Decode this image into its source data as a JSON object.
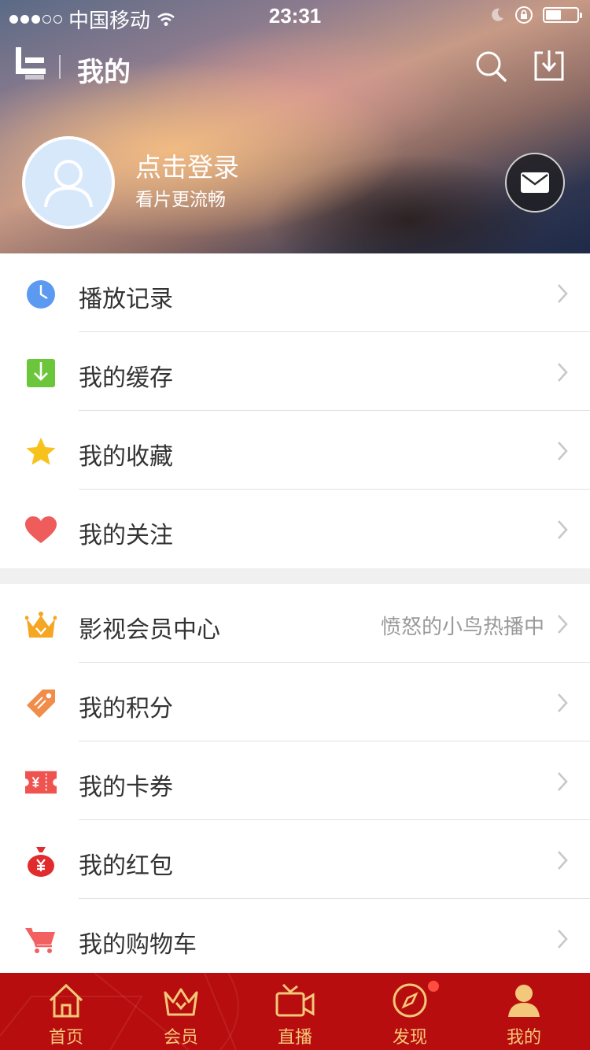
{
  "status_bar": {
    "carrier": "中国移动",
    "time": "23:31"
  },
  "header": {
    "title": "我的",
    "login_title": "点击登录",
    "login_subtitle": "看片更流畅"
  },
  "menu_group_1": [
    {
      "label": "播放记录",
      "icon": "clock-icon",
      "color": "#5b9af0"
    },
    {
      "label": "我的缓存",
      "icon": "download-box-icon",
      "color": "#6cc63c"
    },
    {
      "label": "我的收藏",
      "icon": "star-icon",
      "color": "#f7c21c"
    },
    {
      "label": "我的关注",
      "icon": "heart-icon",
      "color": "#ef5c5c"
    }
  ],
  "menu_group_2": [
    {
      "label": "影视会员中心",
      "extra": "愤怒的小鸟热播中",
      "icon": "crown-icon",
      "color": "#f5a623"
    },
    {
      "label": "我的积分",
      "icon": "tag-icon",
      "color": "#f08d4b"
    },
    {
      "label": "我的卡券",
      "icon": "ticket-icon",
      "color": "#ef5350"
    },
    {
      "label": "我的红包",
      "icon": "money-bag-icon",
      "color": "#e02c2c"
    },
    {
      "label": "我的购物车",
      "icon": "cart-icon",
      "color": "#f26060"
    }
  ],
  "tab_bar": {
    "background": "#b80d0e",
    "label_color": "#f4c87a",
    "tabs": [
      {
        "label": "首页",
        "icon": "home-icon"
      },
      {
        "label": "会员",
        "icon": "crown-icon"
      },
      {
        "label": "直播",
        "icon": "video-camera-icon"
      },
      {
        "label": "发现",
        "icon": "compass-icon"
      },
      {
        "label": "我的",
        "icon": "user-icon"
      }
    ]
  }
}
